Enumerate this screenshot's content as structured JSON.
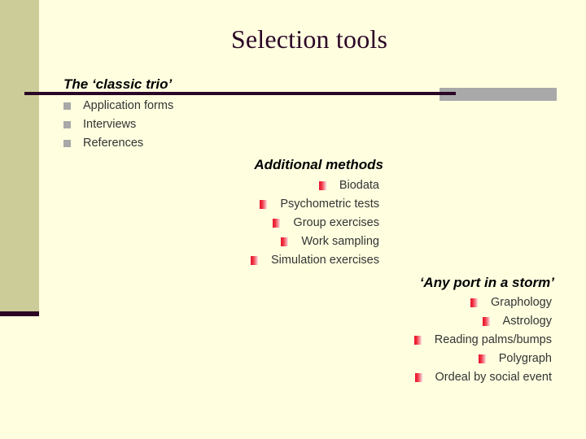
{
  "slide": {
    "title": "Selection tools",
    "background_color": "#FFFFE0",
    "band_color": "#CCCC99",
    "accent_color": "#2B0626",
    "gray_bar_color": "#A9A9A9",
    "bullet_gray_color": "#A8A8A8",
    "bullet_red_color": "#E8112D"
  },
  "sections": {
    "classic_trio": {
      "heading": "The ‘classic trio’",
      "items": [
        "Application forms",
        "Interviews",
        "References"
      ]
    },
    "additional_methods": {
      "heading": "Additional methods",
      "items": [
        "Biodata",
        "Psychometric tests",
        "Group exercises",
        "Work sampling",
        "Simulation exercises"
      ]
    },
    "any_port": {
      "heading": "‘Any port in a storm’",
      "items": [
        "Graphology",
        "Astrology",
        "Reading palms/bumps",
        "Polygraph",
        "Ordeal by social event"
      ]
    }
  }
}
